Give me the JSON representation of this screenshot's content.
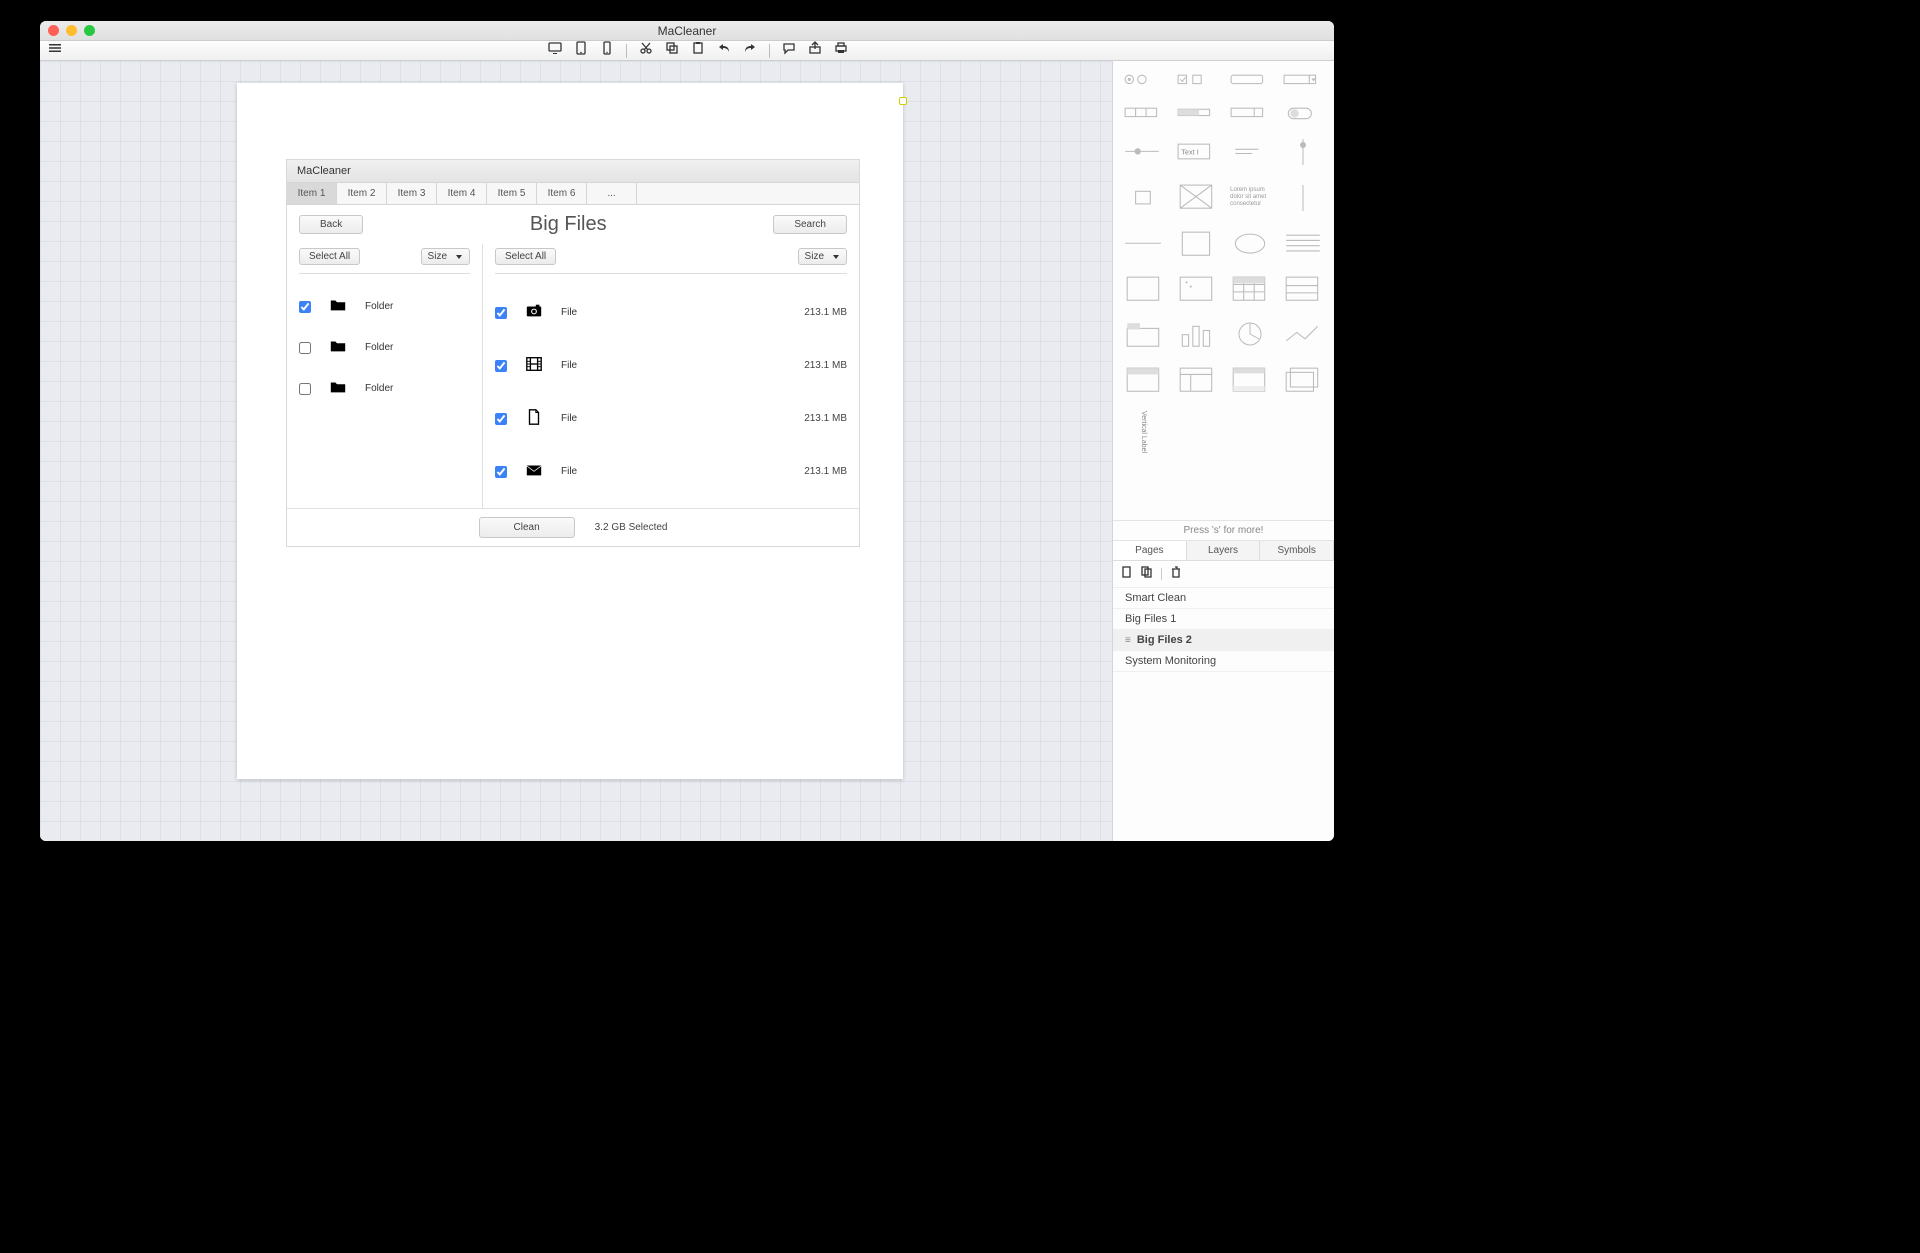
{
  "window": {
    "title": "MaCleaner"
  },
  "mockup": {
    "title": "MaCleaner",
    "tabs": [
      "Item 1",
      "Item 2",
      "Item 3",
      "Item 4",
      "Item 5",
      "Item 6",
      "..."
    ],
    "back": "Back",
    "search": "Search",
    "heading": "Big Files",
    "selectAll": "Select All",
    "sizeDropdown": "Size",
    "folders": [
      {
        "checked": true,
        "label": "Folder"
      },
      {
        "checked": false,
        "label": "Folder"
      },
      {
        "checked": false,
        "label": "Folder"
      }
    ],
    "files": [
      {
        "checked": true,
        "label": "File",
        "size": "213.1 MB",
        "icon": "camera"
      },
      {
        "checked": true,
        "label": "File",
        "size": "213.1 MB",
        "icon": "film"
      },
      {
        "checked": true,
        "label": "File",
        "size": "213.1 MB",
        "icon": "document"
      },
      {
        "checked": true,
        "label": "File",
        "size": "213.1 MB",
        "icon": "mail"
      }
    ],
    "cleanBtn": "Clean",
    "selectedText": "3.2 GB Selected"
  },
  "palette": {
    "hint": "Press 's' for more!",
    "lorem": "Lorem ipsum dolor sit amet consectetur",
    "textInputLabel": "Text I",
    "verticalLabel": "Vertical Label"
  },
  "panel": {
    "tabs": [
      "Pages",
      "Layers",
      "Symbols"
    ],
    "pages": [
      "Smart Clean",
      "Big Files 1",
      "Big Files 2",
      "System Monitoring"
    ],
    "activeIndex": 2
  }
}
